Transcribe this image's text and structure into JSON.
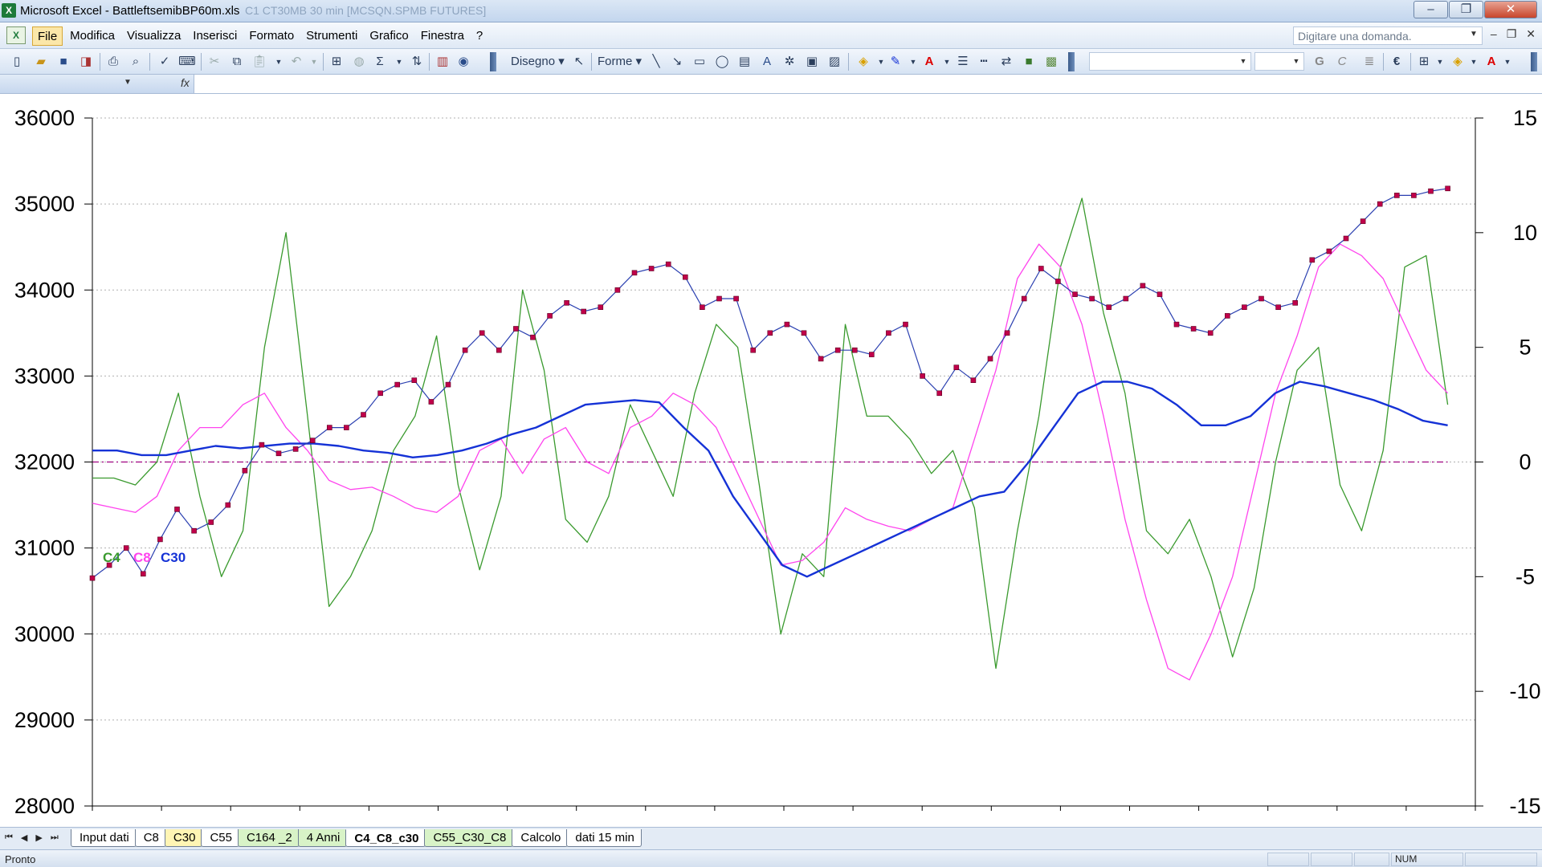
{
  "window": {
    "app_title": "Microsoft Excel - BattleftsemibBP60m.xls",
    "ghost_title": "C1 CT30MB 30 min [MCSQN.SPMB FUTURES]",
    "min_icon": "minimize-icon",
    "max_icon": "maximize-icon",
    "close_icon": "close-icon"
  },
  "menu": {
    "items": [
      "File",
      "Modifica",
      "Visualizza",
      "Inserisci",
      "Formato",
      "Strumenti",
      "Grafico",
      "Finestra",
      "?"
    ],
    "active_index": 0,
    "help_placeholder": "Digitare una domanda."
  },
  "toolbar": {
    "disegno_label": "Disegno",
    "forme_label": "Forme",
    "euro_symbol": "€",
    "bold_label": "G",
    "italic_label": "C"
  },
  "colors": {
    "c4": "#3a9a2e",
    "c8": "#ff44ee",
    "c30": "#1532d6",
    "price": "#c0004a",
    "price_line": "#2a3fb0",
    "zero_line": "#a00080"
  },
  "chart_data": {
    "type": "line",
    "left_axis": {
      "ylim": [
        28000,
        36000
      ],
      "ticks": [
        "36000",
        "35000",
        "34000",
        "33000",
        "32000",
        "31000",
        "30000",
        "29000",
        "28000"
      ]
    },
    "right_axis": {
      "ylim": [
        -15,
        15
      ],
      "ticks": [
        "15",
        "10",
        "5",
        "0",
        "-5",
        "-10",
        "-15"
      ]
    },
    "x": [
      0,
      5,
      10,
      15,
      20,
      25,
      30,
      35,
      40,
      45,
      50,
      55,
      60,
      65,
      70,
      75,
      80,
      85,
      90,
      95,
      100
    ],
    "grid": "horizontal-dashed",
    "legend_labels": [
      "C4",
      "C8",
      "C30"
    ],
    "price": {
      "axis": "left",
      "values": [
        30650,
        30800,
        31000,
        30700,
        31100,
        31450,
        31200,
        31300,
        31500,
        31900,
        32200,
        32100,
        32150,
        32250,
        32400,
        32400,
        32550,
        32800,
        32900,
        32950,
        32700,
        32900,
        33300,
        33500,
        33300,
        33550,
        33450,
        33700,
        33850,
        33750,
        33800,
        34000,
        34200,
        34250,
        34300,
        34150,
        33800,
        33900,
        33900,
        33300,
        33500,
        33600,
        33500,
        33200,
        33300,
        33300,
        33250,
        33500,
        33600,
        33000,
        32800,
        33100,
        32950,
        33200,
        33500,
        33900,
        34250,
        34100,
        33950,
        33900,
        33800,
        33900,
        34050,
        33950,
        33600,
        33550,
        33500,
        33700,
        33800,
        33900,
        33800,
        33850,
        34350,
        34450,
        34600,
        34800,
        35000,
        35100,
        35100,
        35150,
        35180
      ]
    },
    "series": [
      {
        "name": "C4",
        "axis": "right",
        "values": [
          -0.7,
          -0.7,
          -1.0,
          0.0,
          3.0,
          -1.5,
          -5.0,
          -3.0,
          5.0,
          10.0,
          2.0,
          -6.3,
          -5.0,
          -3.0,
          0.5,
          2.0,
          5.5,
          -1.0,
          -4.7,
          -1.5,
          7.5,
          4.0,
          -2.5,
          -3.5,
          -1.5,
          2.5,
          0.5,
          -1.5,
          3.0,
          6.0,
          5.0,
          -1.0,
          -7.5,
          -4.0,
          -5.0,
          6.0,
          2.0,
          2.0,
          1.0,
          -0.5,
          0.5,
          -2.0,
          -9.0,
          -3.0,
          2.0,
          8.5,
          11.5,
          6.5,
          3.0,
          -3.0,
          -4.0,
          -2.5,
          -5.0,
          -8.5,
          -5.5,
          0.0,
          4.0,
          5.0,
          -1.0,
          -3.0,
          0.5,
          8.5,
          9.0,
          2.5
        ]
      },
      {
        "name": "C8",
        "axis": "right",
        "values": [
          -1.8,
          -2.0,
          -2.2,
          -1.5,
          0.5,
          1.5,
          1.5,
          2.5,
          3.0,
          1.5,
          0.5,
          -0.8,
          -1.2,
          -1.1,
          -1.5,
          -2.0,
          -2.2,
          -1.5,
          0.5,
          1.0,
          -0.5,
          1.0,
          1.5,
          0.0,
          -0.5,
          1.5,
          2.0,
          3.0,
          2.5,
          1.5,
          -0.5,
          -2.5,
          -4.5,
          -4.3,
          -3.5,
          -2.0,
          -2.5,
          -2.8,
          -3.0,
          -2.5,
          -2.0,
          1.0,
          4.0,
          8.0,
          9.5,
          8.5,
          6.0,
          2.0,
          -2.5,
          -6.0,
          -9.0,
          -9.5,
          -7.5,
          -5.0,
          -1.0,
          3.0,
          5.5,
          8.5,
          9.5,
          9.0,
          8.0,
          6.0,
          4.0,
          3.0
        ]
      },
      {
        "name": "C30",
        "axis": "right",
        "values": [
          0.5,
          0.5,
          0.3,
          0.3,
          0.5,
          0.7,
          0.6,
          0.7,
          0.8,
          0.8,
          0.7,
          0.5,
          0.4,
          0.2,
          0.3,
          0.5,
          0.8,
          1.2,
          1.5,
          2.0,
          2.5,
          2.6,
          2.7,
          2.6,
          1.5,
          0.5,
          -1.5,
          -3.0,
          -4.5,
          -5.0,
          -4.5,
          -4.0,
          -3.5,
          -3.0,
          -2.5,
          -2.0,
          -1.5,
          -1.3,
          0.0,
          1.5,
          3.0,
          3.5,
          3.5,
          3.2,
          2.5,
          1.6,
          1.6,
          2.0,
          3.0,
          3.5,
          3.3,
          3.0,
          2.7,
          2.3,
          1.8,
          1.6
        ]
      }
    ],
    "zero_line": 0
  },
  "sheet_tabs": [
    {
      "label": "Input dati",
      "style": "white"
    },
    {
      "label": "C8",
      "style": "white"
    },
    {
      "label": "C30",
      "style": "yellow"
    },
    {
      "label": "C55",
      "style": "white"
    },
    {
      "label": "C164 _2",
      "style": "green"
    },
    {
      "label": "4 Anni",
      "style": "green"
    },
    {
      "label": "C4_C8_c30",
      "style": "active"
    },
    {
      "label": "C55_C30_C8",
      "style": "green"
    },
    {
      "label": "Calcolo",
      "style": "white"
    },
    {
      "label": "dati 15 min",
      "style": "white"
    }
  ],
  "status": {
    "text": "Pronto",
    "num_indicator": "NUM"
  }
}
